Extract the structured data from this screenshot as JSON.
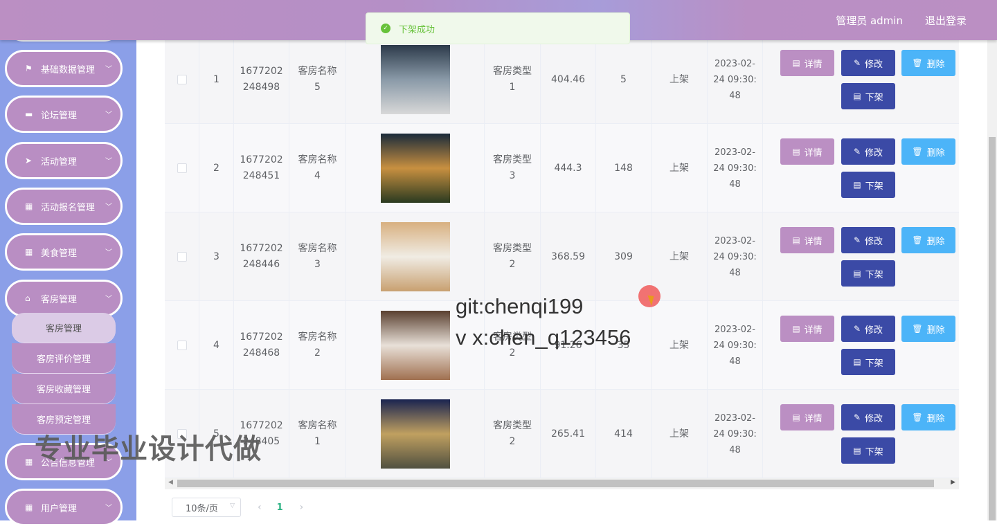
{
  "header": {
    "user": "管理员 admin",
    "logout": "退出登录"
  },
  "toast": {
    "message": "下架成功"
  },
  "sidebar": {
    "items": [
      {
        "label": "基础数据管理",
        "icon": "flag-icon"
      },
      {
        "label": "论坛管理",
        "icon": "chat-icon"
      },
      {
        "label": "活动管理",
        "icon": "send-icon"
      },
      {
        "label": "活动报名管理",
        "icon": "grid-icon"
      },
      {
        "label": "美食管理",
        "icon": "grid-icon"
      },
      {
        "label": "客房管理",
        "icon": "home-icon"
      }
    ],
    "sub_items": [
      "客房管理",
      "客房评价管理",
      "客房收藏管理",
      "客房预定管理"
    ],
    "items_after": [
      {
        "label": "公告信息管理",
        "icon": "grid-icon"
      },
      {
        "label": "用户管理",
        "icon": "grid-icon"
      }
    ]
  },
  "actions": {
    "detail": "详情",
    "edit": "修改",
    "delete": "删除",
    "off_shelf": "下架"
  },
  "rows": [
    {
      "index": "1",
      "id": "1677202248498",
      "name": "客房名称5",
      "type": "客房类型1",
      "price": "404.46",
      "count": "5",
      "status": "上架",
      "date": "2023-02-24 09:30:48",
      "img": [
        "#2c3a4a",
        "#8a9aa8",
        "#d8d8d8"
      ]
    },
    {
      "index": "2",
      "id": "1677202248451",
      "name": "客房名称4",
      "type": "客房类型3",
      "price": "444.3",
      "count": "148",
      "status": "上架",
      "date": "2023-02-24 09:30:48",
      "img": [
        "#1a2a3a",
        "#c89040",
        "#2a3a20"
      ]
    },
    {
      "index": "3",
      "id": "1677202248446",
      "name": "客房名称3",
      "type": "客房类型2",
      "price": "368.59",
      "count": "309",
      "status": "上架",
      "date": "2023-02-24 09:30:48",
      "img": [
        "#d8b080",
        "#f0ece4",
        "#c8a070"
      ]
    },
    {
      "index": "4",
      "id": "1677202248468",
      "name": "客房名称2",
      "type": "客房类型2",
      "price": "91.26",
      "count": "35",
      "status": "上架",
      "date": "2023-02-24 09:30:48",
      "img": [
        "#5a4030",
        "#e8e0d8",
        "#a07050"
      ]
    },
    {
      "index": "5",
      "id": "1677202248405",
      "name": "客房名称1",
      "type": "客房类型2",
      "price": "265.41",
      "count": "414",
      "status": "上架",
      "date": "2023-02-24 09:30:48",
      "img": [
        "#1a2450",
        "#c0a060",
        "#505040"
      ]
    }
  ],
  "pagination": {
    "page_size": "10条/页",
    "current_page": "1"
  },
  "watermarks": {
    "git": "git:chenqi199",
    "wx": "v x:chen_q123456",
    "ad": "专业毕业设计代做"
  }
}
